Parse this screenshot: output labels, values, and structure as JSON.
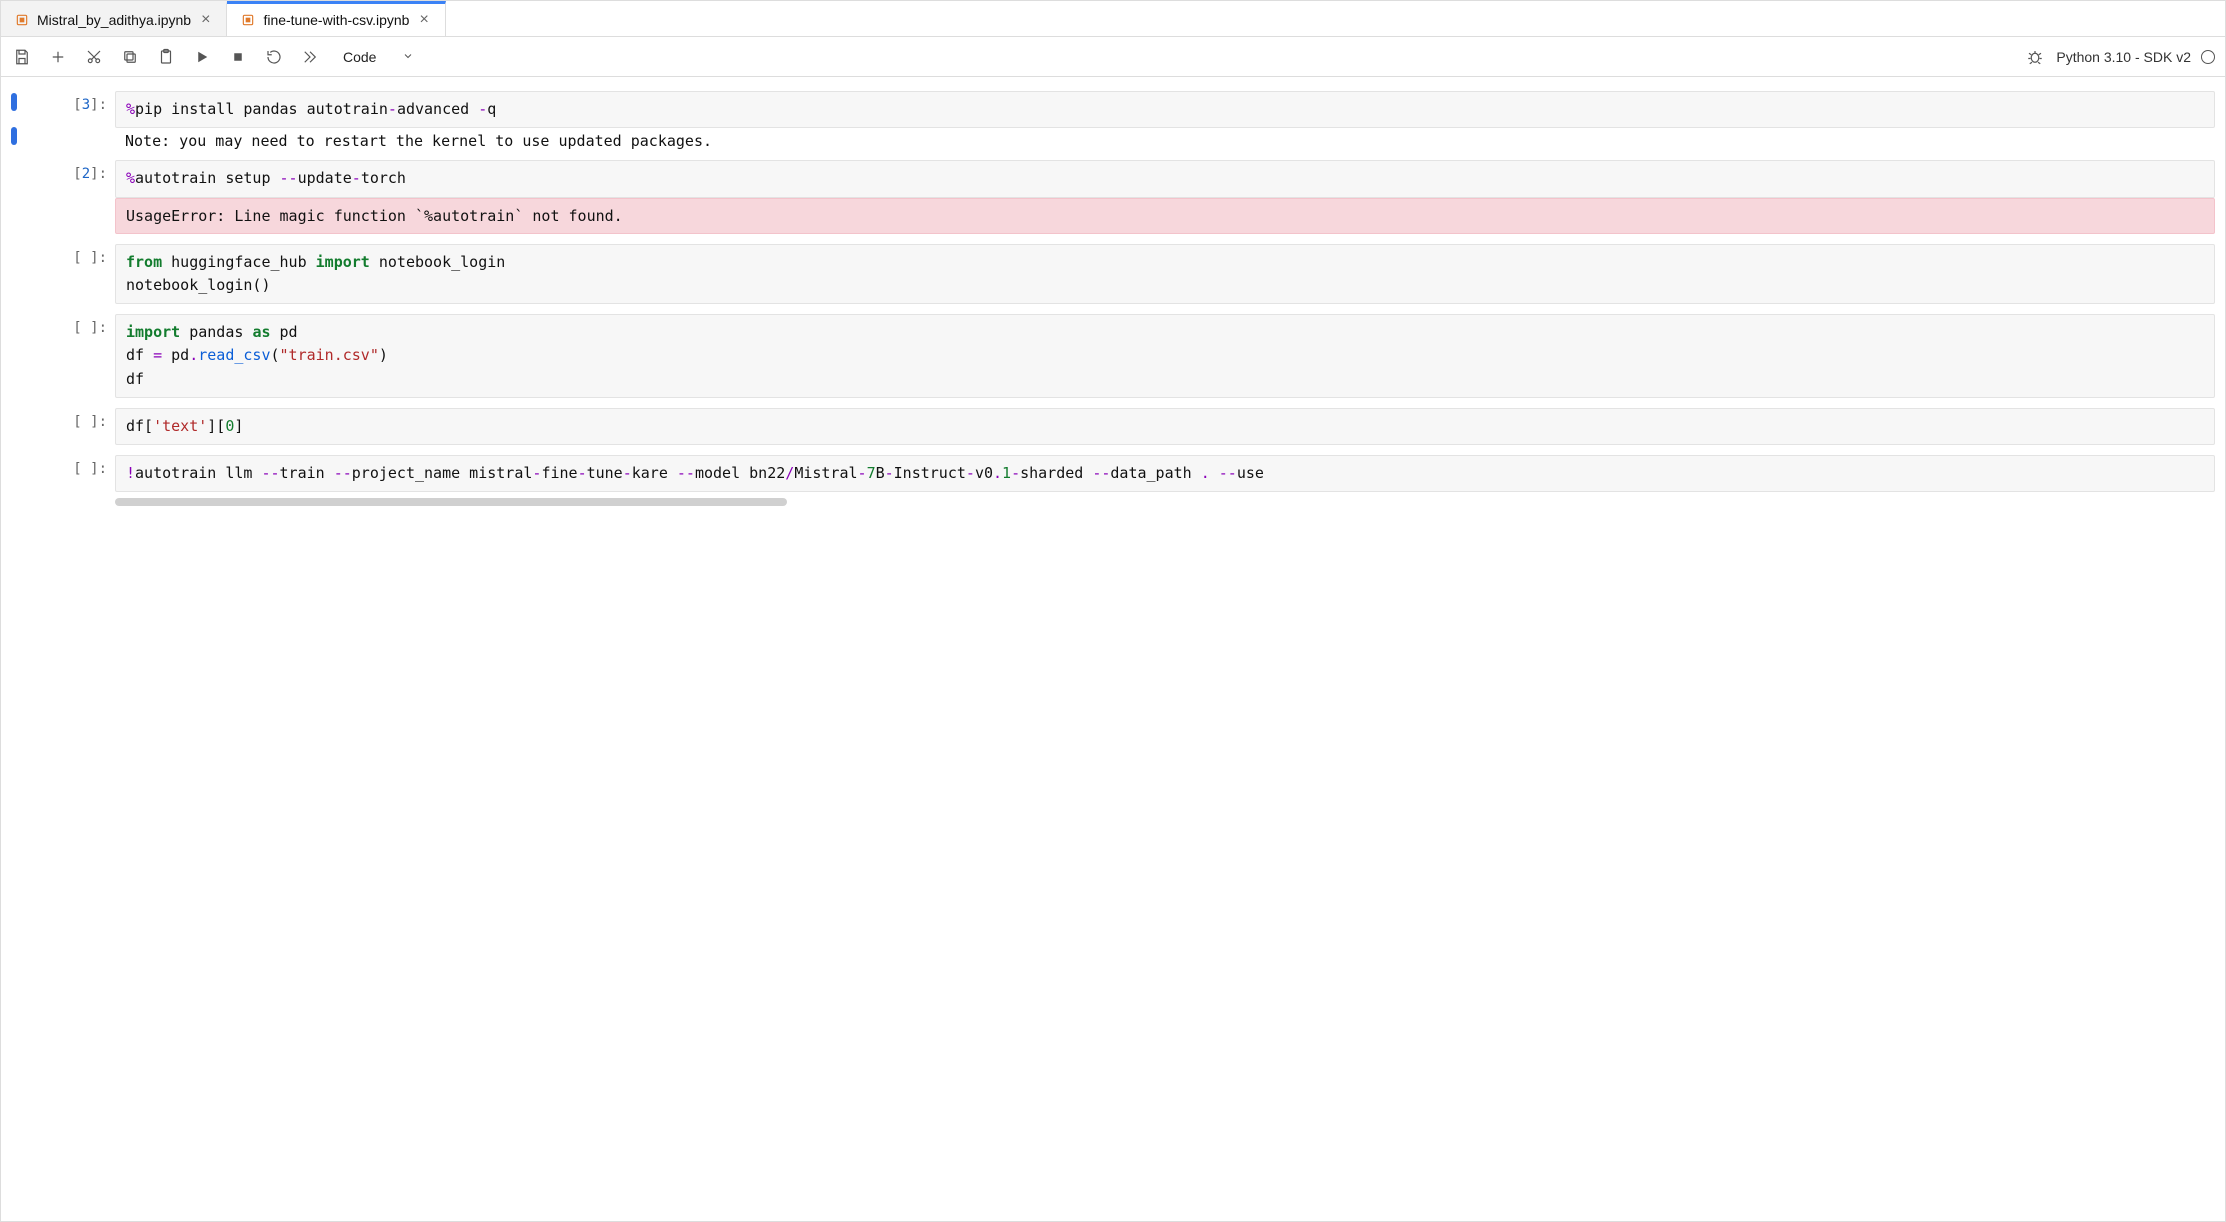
{
  "tabs": [
    {
      "label": "Mistral_by_adithya.ipynb",
      "active": false
    },
    {
      "label": "fine-tune-with-csv.ipynb",
      "active": true
    }
  ],
  "toolbar": {
    "celltype_label": "Code",
    "kernel_label": "Python 3.10 - SDK v2"
  },
  "cells": [
    {
      "prompt": "[3]:",
      "active": true,
      "code_tokens": [
        {
          "t": "magic",
          "v": "%"
        },
        {
          "t": "txt",
          "v": "pip install pandas autotrain"
        },
        {
          "t": "op",
          "v": "-"
        },
        {
          "t": "txt",
          "v": "advanced "
        },
        {
          "t": "op",
          "v": "-"
        },
        {
          "t": "txt",
          "v": "q"
        }
      ],
      "output_plain": "Note: you may need to restart the kernel to use updated packages."
    },
    {
      "prompt": "[2]:",
      "code_tokens": [
        {
          "t": "magic",
          "v": "%"
        },
        {
          "t": "txt",
          "v": "autotrain setup "
        },
        {
          "t": "op",
          "v": "--"
        },
        {
          "t": "txt",
          "v": "update"
        },
        {
          "t": "op",
          "v": "-"
        },
        {
          "t": "txt",
          "v": "torch"
        }
      ],
      "output_error": "UsageError: Line magic function `%autotrain` not found."
    },
    {
      "prompt": "[ ]:",
      "code_tokens": [
        {
          "t": "kw",
          "v": "from"
        },
        {
          "t": "txt",
          "v": " huggingface_hub "
        },
        {
          "t": "kw",
          "v": "import"
        },
        {
          "t": "txt",
          "v": " notebook_login\nnotebook_login()"
        }
      ]
    },
    {
      "prompt": "[ ]:",
      "code_tokens": [
        {
          "t": "kw",
          "v": "import"
        },
        {
          "t": "txt",
          "v": " pandas "
        },
        {
          "t": "kw",
          "v": "as"
        },
        {
          "t": "txt",
          "v": " pd\ndf "
        },
        {
          "t": "op",
          "v": "="
        },
        {
          "t": "txt",
          "v": " pd"
        },
        {
          "t": "op",
          "v": "."
        },
        {
          "t": "func",
          "v": "read_csv"
        },
        {
          "t": "txt",
          "v": "("
        },
        {
          "t": "str",
          "v": "\"train.csv\""
        },
        {
          "t": "txt",
          "v": ")\ndf"
        }
      ]
    },
    {
      "prompt": "[ ]:",
      "code_tokens": [
        {
          "t": "txt",
          "v": "df["
        },
        {
          "t": "str",
          "v": "'text'"
        },
        {
          "t": "txt",
          "v": "]["
        },
        {
          "t": "num",
          "v": "0"
        },
        {
          "t": "txt",
          "v": "]"
        }
      ]
    },
    {
      "prompt": "[ ]:",
      "has_hscroll": true,
      "code_tokens": [
        {
          "t": "bang",
          "v": "!"
        },
        {
          "t": "txt",
          "v": "autotrain llm "
        },
        {
          "t": "op",
          "v": "--"
        },
        {
          "t": "txt",
          "v": "train "
        },
        {
          "t": "op",
          "v": "--"
        },
        {
          "t": "txt",
          "v": "project_name mistral"
        },
        {
          "t": "op",
          "v": "-"
        },
        {
          "t": "txt",
          "v": "fine"
        },
        {
          "t": "op",
          "v": "-"
        },
        {
          "t": "txt",
          "v": "tune"
        },
        {
          "t": "op",
          "v": "-"
        },
        {
          "t": "txt",
          "v": "kare "
        },
        {
          "t": "op",
          "v": "--"
        },
        {
          "t": "txt",
          "v": "model bn22"
        },
        {
          "t": "slash",
          "v": "/"
        },
        {
          "t": "txt",
          "v": "Mistral"
        },
        {
          "t": "op",
          "v": "-"
        },
        {
          "t": "num",
          "v": "7"
        },
        {
          "t": "txt",
          "v": "B"
        },
        {
          "t": "op",
          "v": "-"
        },
        {
          "t": "txt",
          "v": "Instruct"
        },
        {
          "t": "op",
          "v": "-"
        },
        {
          "t": "txt",
          "v": "v0"
        },
        {
          "t": "op",
          "v": "."
        },
        {
          "t": "num",
          "v": "1"
        },
        {
          "t": "op",
          "v": "-"
        },
        {
          "t": "txt",
          "v": "sharded "
        },
        {
          "t": "op",
          "v": "--"
        },
        {
          "t": "txt",
          "v": "data_path "
        },
        {
          "t": "op",
          "v": "."
        },
        {
          "t": "txt",
          "v": " "
        },
        {
          "t": "op",
          "v": "--"
        },
        {
          "t": "txt",
          "v": "use"
        }
      ]
    }
  ]
}
